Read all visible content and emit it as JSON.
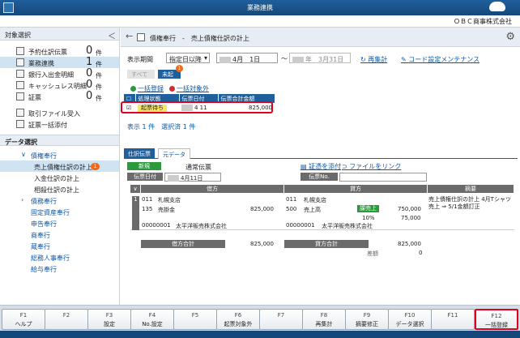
{
  "window": {
    "title": "業務連携",
    "company": "ＯＢＣ商事株式会社"
  },
  "left": {
    "header": "対象選択",
    "counters": [
      {
        "label": "予約仕訳伝票",
        "count": "0",
        "unit": "件"
      },
      {
        "label": "業務連携",
        "count": "1",
        "unit": "件"
      },
      {
        "label": "銀行入出金明細",
        "count": "0",
        "unit": "件"
      },
      {
        "label": "キャッシュレス明細",
        "count": "0",
        "unit": "件"
      },
      {
        "label": "証票",
        "count": "0",
        "unit": "件"
      }
    ],
    "links": [
      "取引ファイル受入",
      "証票一括添付"
    ],
    "data_section": "データ選択",
    "tree": [
      {
        "label": "債権奉行"
      },
      {
        "label": "売上債権仕訳の計上",
        "badge": "1"
      },
      {
        "label": "入金仕訳の計上"
      },
      {
        "label": "相殺仕訳の計上"
      },
      {
        "label": "債務奉行"
      },
      {
        "label": "固定資産奉行"
      },
      {
        "label": "申告奉行"
      },
      {
        "label": "商奉行"
      },
      {
        "label": "蔵奉行"
      },
      {
        "label": "総務人事奉行"
      },
      {
        "label": "給与奉行"
      }
    ]
  },
  "main": {
    "breadcrumb": "債権奉行　-　売上債権仕訳の計上",
    "period_label": "表示期間",
    "period_select": "指定日以降",
    "date_from": "4月　1日",
    "tilde": "～",
    "date_to": "年　3月31日",
    "refresh": "再集計",
    "code_setting": "コード設定メンテナンス",
    "filter_all": "すべて",
    "filter_unposted": "未起票",
    "filter_badge": "1",
    "bulk_register": "一括登録",
    "bulk_exclude": "一括対象外",
    "columns": [
      "処理状態",
      "伝票日付",
      "伝票合計金額"
    ],
    "row": {
      "status": "起票待ち",
      "date": "4 11",
      "amount": "825,000"
    },
    "summary": "表示 1 件　選択済 1 件",
    "tabs": [
      "仕訳伝票",
      "元データ"
    ],
    "slip": {
      "kind": "新規",
      "type": "通常伝票",
      "attach": "証憑を添付",
      "link": "ファイルをリンク",
      "date_label": "伝票日付",
      "date": "4月11日",
      "slipno_label": "伝票No."
    },
    "journal": {
      "debit_h": "借方",
      "credit_h": "貸方",
      "memo_h": "摘要",
      "line_no": "1",
      "debit_dept_code": "011",
      "debit_dept": "札幌支店",
      "debit_acct_code": "135",
      "debit_acct": "売掛金",
      "debit_amount": "825,000",
      "debit_partner_code": "00000001",
      "debit_partner": "太平洋販売株式会社",
      "credit_dept_code": "011",
      "credit_dept": "札幌支店",
      "credit_acct_code": "500",
      "credit_acct": "売上高",
      "tax_tag": "課売上",
      "tax_rate": "10%",
      "credit_amount": "750,000",
      "credit_tax": "75,000",
      "credit_partner_code": "00000001",
      "credit_partner": "太平洋販売株式会社",
      "memo": "売上債権仕訳の計上 4月Tシャツ売上 ⇒ 5/1金額訂正",
      "debit_total_label": "借方合計",
      "debit_total": "825,000",
      "credit_total_label": "貸方合計",
      "credit_total": "825,000",
      "diff_label": "差額",
      "diff": "0"
    }
  },
  "fkeys": [
    {
      "key": "F1",
      "label": "ヘルプ"
    },
    {
      "key": "F2",
      "label": ""
    },
    {
      "key": "F3",
      "label": "設定"
    },
    {
      "key": "F4",
      "label": "No.設定"
    },
    {
      "key": "F5",
      "label": ""
    },
    {
      "key": "F6",
      "label": "起票対象外"
    },
    {
      "key": "F7",
      "label": ""
    },
    {
      "key": "F8",
      "label": "再集計"
    },
    {
      "key": "F9",
      "label": "摘要修正"
    },
    {
      "key": "F10",
      "label": "データ選択"
    },
    {
      "key": "F11",
      "label": ""
    },
    {
      "key": "F12",
      "label": "一括登録"
    }
  ]
}
